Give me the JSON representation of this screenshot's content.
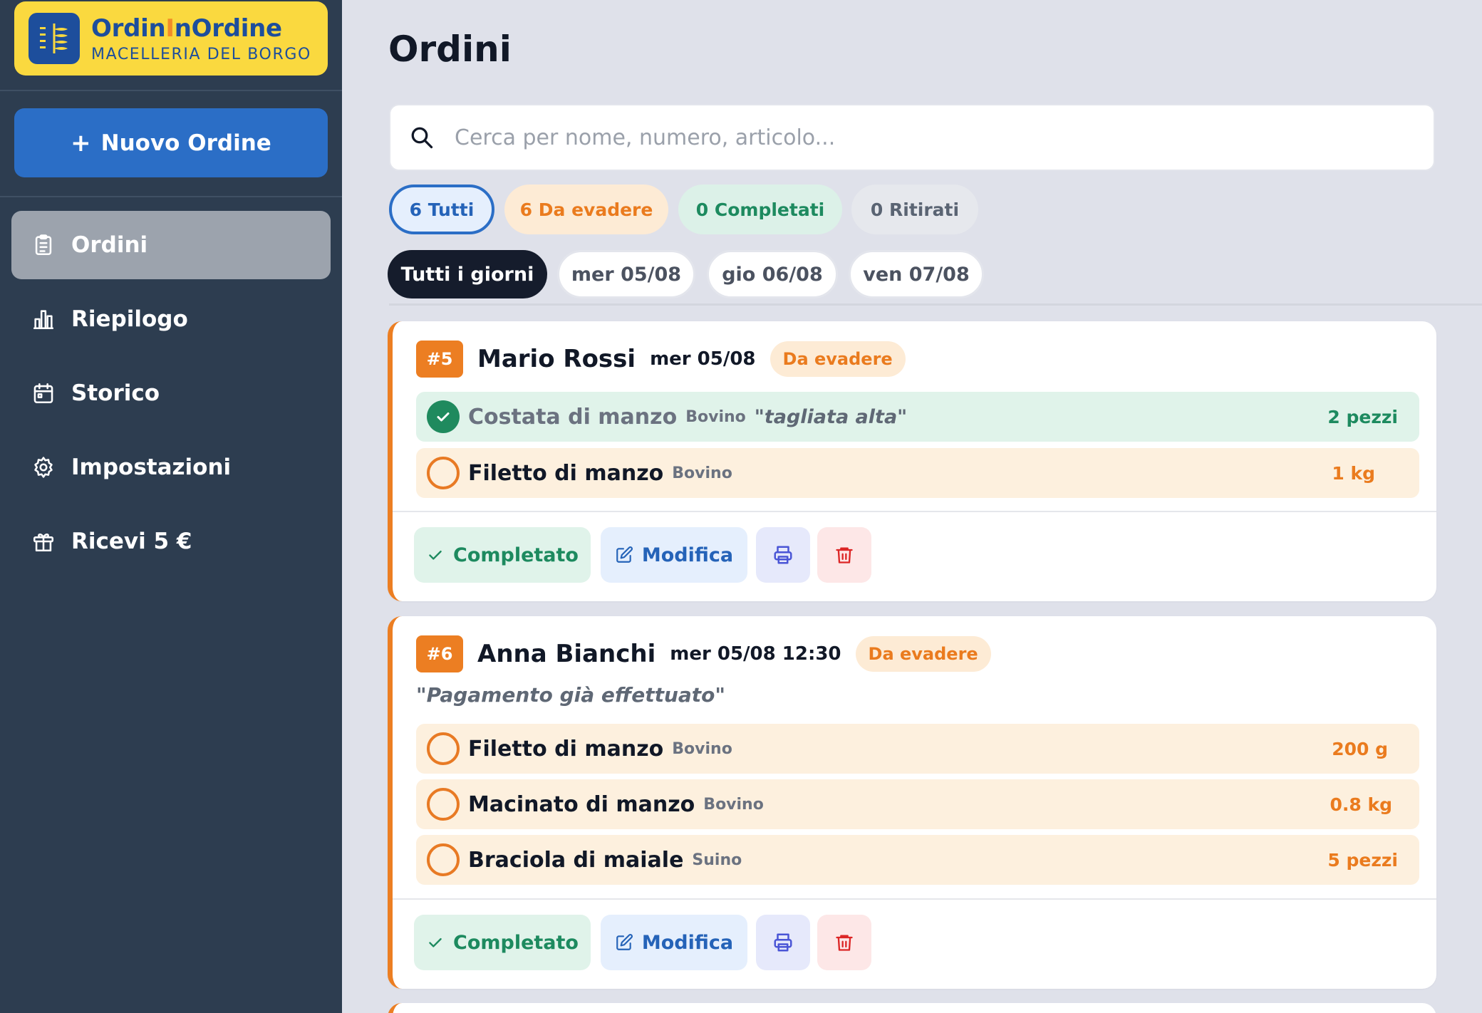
{
  "brand": {
    "name_part1": "OrdinInOrdine",
    "subtitle": "MACELLERIA DEL BORGO"
  },
  "sidebar": {
    "new_order": {
      "plus": "+",
      "label": "Nuovo Ordine"
    },
    "items": [
      {
        "label": "Ordini",
        "icon": "clipboard-icon",
        "active": true
      },
      {
        "label": "Riepilogo",
        "icon": "bar-chart-icon",
        "active": false
      },
      {
        "label": "Storico",
        "icon": "calendar-icon",
        "active": false
      },
      {
        "label": "Impostazioni",
        "icon": "gear-icon",
        "active": false
      },
      {
        "label": "Ricevi 5 €",
        "icon": "gift-icon",
        "active": false
      }
    ]
  },
  "page": {
    "title": "Ordini"
  },
  "search": {
    "placeholder": "Cerca per nome, numero, articolo...",
    "value": ""
  },
  "stats": [
    {
      "label": "6 Tutti",
      "selected": true
    },
    {
      "label": "6 Da evadere",
      "selected": false
    },
    {
      "label": "0 Completati",
      "selected": false
    },
    {
      "label": "0 Ritirati",
      "selected": false
    }
  ],
  "days": [
    {
      "label": "Tutti i giorni",
      "selected": true
    },
    {
      "label": "mer 05/08",
      "selected": false
    },
    {
      "label": "gio 06/08",
      "selected": false
    },
    {
      "label": "ven 07/08",
      "selected": false
    }
  ],
  "orders": [
    {
      "number": "#5",
      "customer": "Mario Rossi",
      "date": "mer 05/08",
      "status": "Da evadere",
      "note": "",
      "items": [
        {
          "name": "Costata di manzo",
          "category": "Bovino",
          "note": "\"tagliata alta\"",
          "qty": "2 pezzi",
          "done": true
        },
        {
          "name": "Filetto di manzo",
          "category": "Bovino",
          "note": "",
          "qty": "1 kg",
          "done": false
        }
      ],
      "actions": {
        "complete": "Completato",
        "edit": "Modifica"
      }
    },
    {
      "number": "#6",
      "customer": "Anna Bianchi",
      "date": "mer 05/08 12:30",
      "status": "Da evadere",
      "note": "\"Pagamento già effettuato\"",
      "items": [
        {
          "name": "Filetto di manzo",
          "category": "Bovino",
          "note": "",
          "qty": "200 g",
          "done": false
        },
        {
          "name": "Macinato di manzo",
          "category": "Bovino",
          "note": "",
          "qty": "0.8 kg",
          "done": false
        },
        {
          "name": "Braciola di maiale",
          "category": "Suino",
          "note": "",
          "qty": "5 pezzi",
          "done": false
        }
      ],
      "actions": {
        "complete": "Completato",
        "edit": "Modifica"
      }
    }
  ],
  "colors": {
    "sidebar_bg": "#2d3d50",
    "brand_yellow": "#fad93f",
    "primary_blue": "#2b6ec6",
    "accent_orange": "#ec7e22",
    "success_green": "#1f8a5e",
    "danger_red": "#dc2626"
  }
}
